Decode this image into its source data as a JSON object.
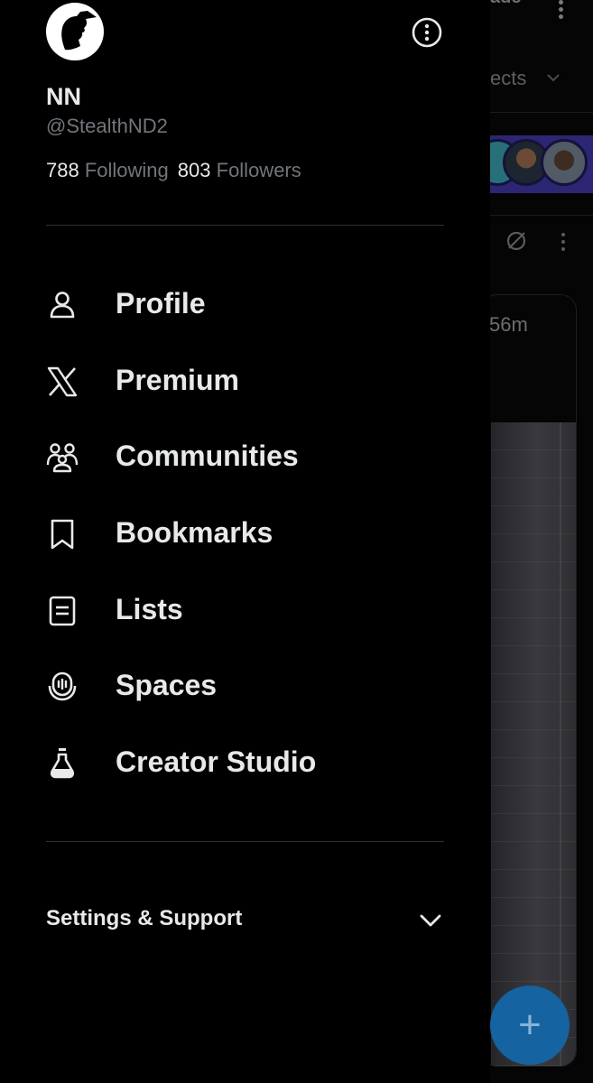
{
  "background": {
    "header_partial_text": "ade",
    "tab_partial_text": "ects",
    "post_time_partial": "56m",
    "fab_symbol": "+"
  },
  "drawer": {
    "profile": {
      "display_name": "NN",
      "handle": "@StealthND2",
      "following_count": "788",
      "following_label": "Following",
      "followers_count": "803",
      "followers_label": "Followers"
    },
    "menu": [
      {
        "label": "Profile",
        "icon": "person-icon"
      },
      {
        "label": "Premium",
        "icon": "x-logo-icon"
      },
      {
        "label": "Communities",
        "icon": "communities-icon"
      },
      {
        "label": "Bookmarks",
        "icon": "bookmark-icon"
      },
      {
        "label": "Lists",
        "icon": "list-icon"
      },
      {
        "label": "Spaces",
        "icon": "spaces-icon"
      },
      {
        "label": "Creator Studio",
        "icon": "flask-icon"
      }
    ],
    "settings_support_label": "Settings & Support"
  },
  "colors": {
    "background": "#000000",
    "primary_text": "#e7e9ea",
    "secondary_text": "#71767b",
    "divider": "#2f3336",
    "fab": "#1563a0"
  }
}
